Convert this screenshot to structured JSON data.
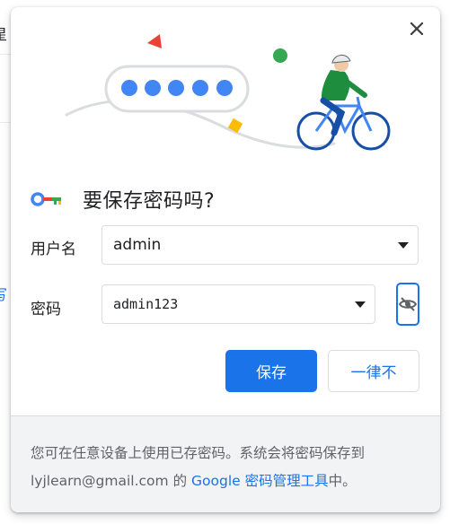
{
  "background": {
    "left_char_top": "星",
    "left_char_mid": "写"
  },
  "dialog": {
    "title": "要保存密码吗?",
    "username_label": "用户名",
    "username_value": "admin",
    "password_label": "密码",
    "password_value": "admin123",
    "save_button": "保存",
    "never_button": "一律不",
    "footer": {
      "text_1": "您可在任意设备上使用已存密码。系统会将密码保存到",
      "account": "lyjlearn@gmail.com",
      "text_2": " 的 ",
      "link": "Google 密码管理工具",
      "text_3": "中。"
    }
  },
  "colors": {
    "accent": "#1a73e8",
    "footer_bg": "#f1f3f4",
    "text": "#202124",
    "secondary_text": "#5f6368"
  },
  "icons": {
    "close": "close-icon",
    "key": "key-icon",
    "dropdown": "caret-down-icon",
    "visibility": "eye-off-icon"
  }
}
